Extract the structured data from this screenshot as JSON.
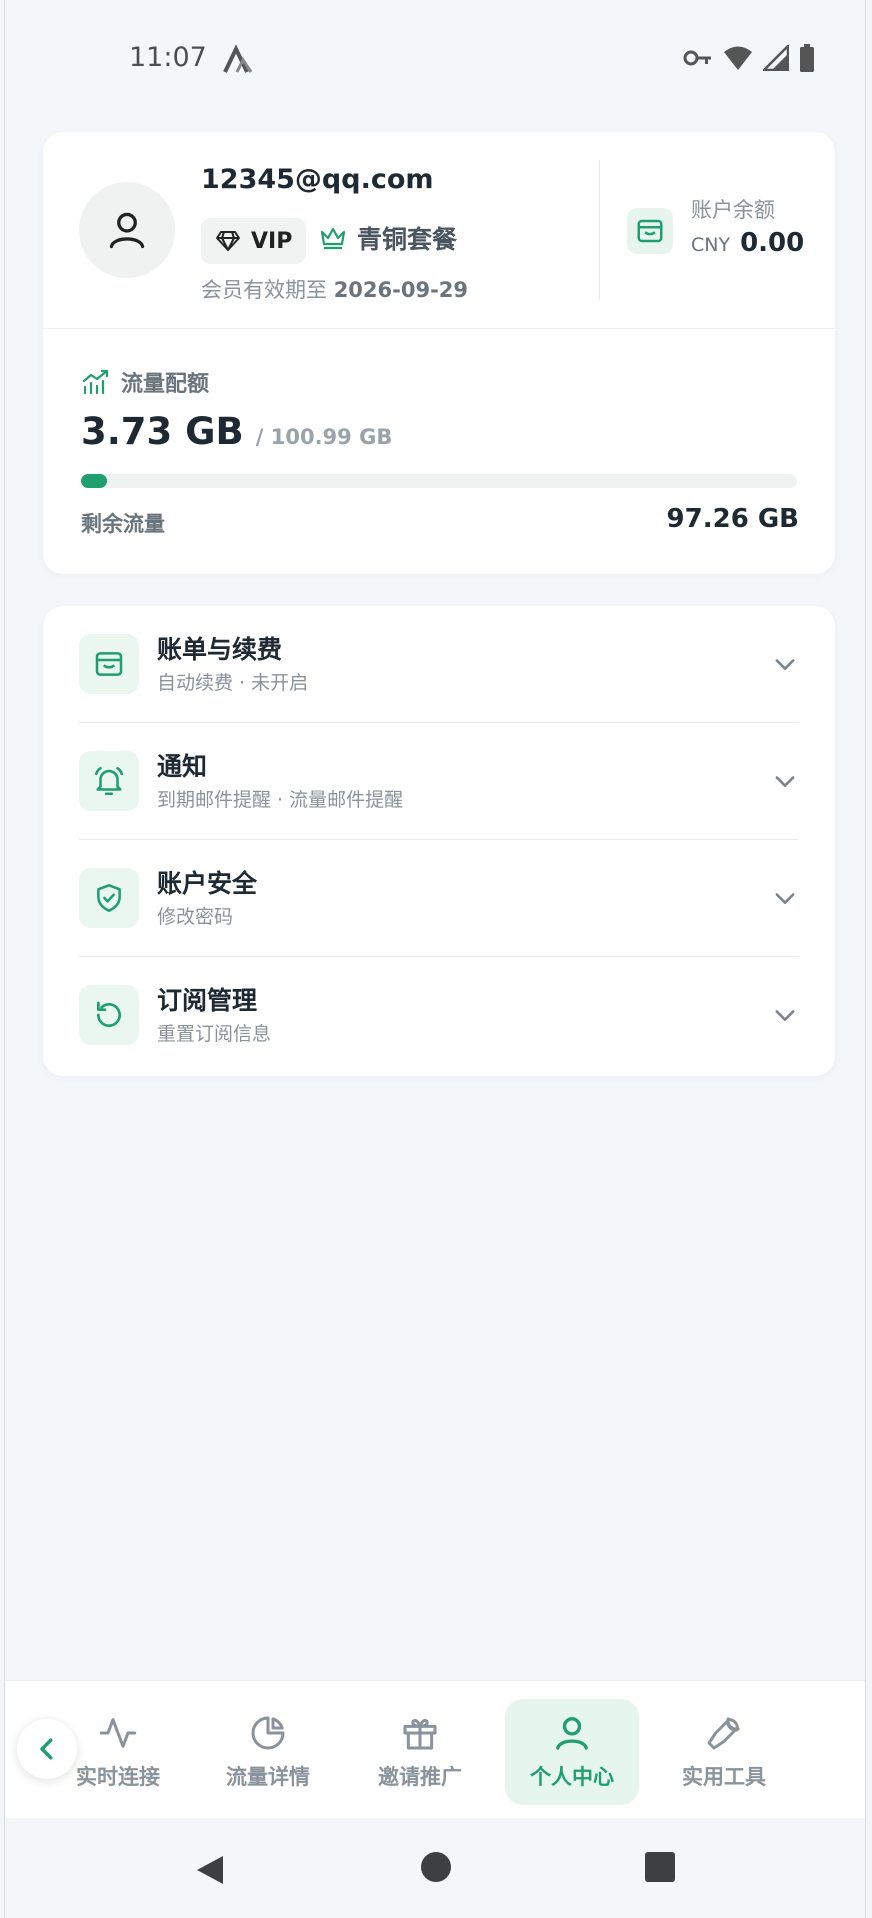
{
  "status_bar": {
    "time": "11:07"
  },
  "profile": {
    "email": "12345@qq.com",
    "vip_label": "VIP",
    "plan_name": "青铜套餐",
    "expiry_prefix": "会员有效期至",
    "expiry_date": "2026-09-29",
    "balance_label": "账户余额",
    "balance_currency": "CNY",
    "balance_amount": "0.00"
  },
  "traffic": {
    "title": "流量配额",
    "used": "3.73 GB",
    "total": "/ 100.99 GB",
    "used_fraction": 0.037,
    "remaining_label": "剩余流量",
    "remaining_value": "97.26 GB"
  },
  "menu": [
    {
      "title": "账单与续费",
      "subtitle": "自动续费 · 未开启",
      "icon": "wallet-icon"
    },
    {
      "title": "通知",
      "subtitle": "到期邮件提醒 · 流量邮件提醒",
      "icon": "bell-icon"
    },
    {
      "title": "账户安全",
      "subtitle": "修改密码",
      "icon": "shield-check-icon"
    },
    {
      "title": "订阅管理",
      "subtitle": "重置订阅信息",
      "icon": "refresh-icon"
    }
  ],
  "bottom_nav": [
    {
      "label": "实时连接",
      "icon": "activity-icon"
    },
    {
      "label": "流量详情",
      "icon": "pie-chart-icon"
    },
    {
      "label": "邀请推广",
      "icon": "gift-icon"
    },
    {
      "label": "个人中心",
      "icon": "user-icon",
      "active": true
    },
    {
      "label": "实用工具",
      "icon": "wrench-icon"
    }
  ],
  "colors": {
    "accent": "#1f9e6e",
    "accent_bg": "#e6f6ee",
    "background": "#f3f7fa"
  }
}
